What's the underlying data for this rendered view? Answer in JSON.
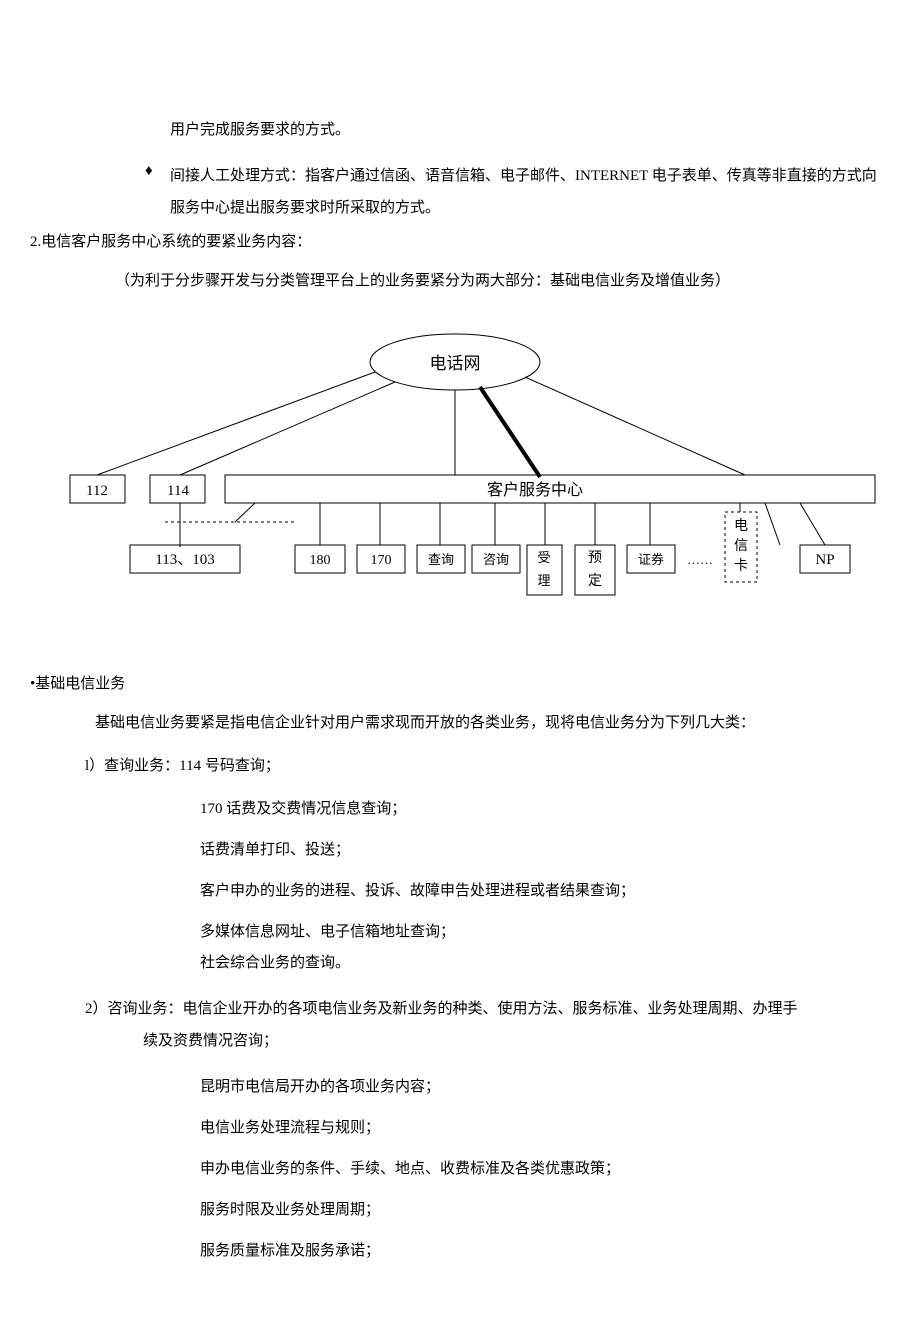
{
  "para_top": "用户完成服务要求的方式。",
  "bullet_diamond": "♦",
  "bullet_text": "间接人工处理方式：指客户通过信函、语音信箱、电子邮件、INTERNET 电子表单、传真等非直接的方式向服务中心提出服务要求时所采取的方式。",
  "sec2_title": "2.电信客户服务中心系统的要紧业务内容：",
  "sec2_sub": "（为利于分步骤开发与分类管理平台上的业务要紧分为两大部分：基础电信业务及增值业务）",
  "diagram": {
    "top": "电话网",
    "left1": "112",
    "left2": "114",
    "center": "客户服务中心",
    "rowA": "113、103",
    "b1": "180",
    "b2": "170",
    "b3": "查询",
    "b4": "咨询",
    "b5a": "受",
    "b5b": "理",
    "b6a": "预",
    "b6b": "定",
    "b7": "证券",
    "dots": "……",
    "card1": "电",
    "card2": "信",
    "card3": "卡",
    "np": "NP"
  },
  "basic_title": "•基础电信业务",
  "basic_desc": "基础电信业务要紧是指电信企业针对用户需求现而开放的各类业务，现将电信业务分为下列几大类：",
  "q1_head": "l）查询业务：114 号码查询；",
  "q1_items": [
    "170 话费及交费情况信息查询；",
    "话费清单打印、投送；",
    "客户申办的业务的进程、投诉、故障申告处理进程或者结果查询；",
    "多媒体信息网址、电子信箱地址查询；",
    "社会综合业务的查询。"
  ],
  "q2_head_a": "2）咨询业务：电信企业开办的各项电信业务及新业务的种类、使用方法、服务标准、业务处理周期、办理手",
  "q2_head_b": "续及资费情况咨询；",
  "q2_items": [
    "昆明市电信局开办的各项业务内容；",
    "电信业务处理流程与规则；",
    "申办电信业务的条件、手续、地点、收费标准及各类优惠政策；",
    "服务时限及业务处理周期；",
    "服务质量标准及服务承诺；"
  ]
}
